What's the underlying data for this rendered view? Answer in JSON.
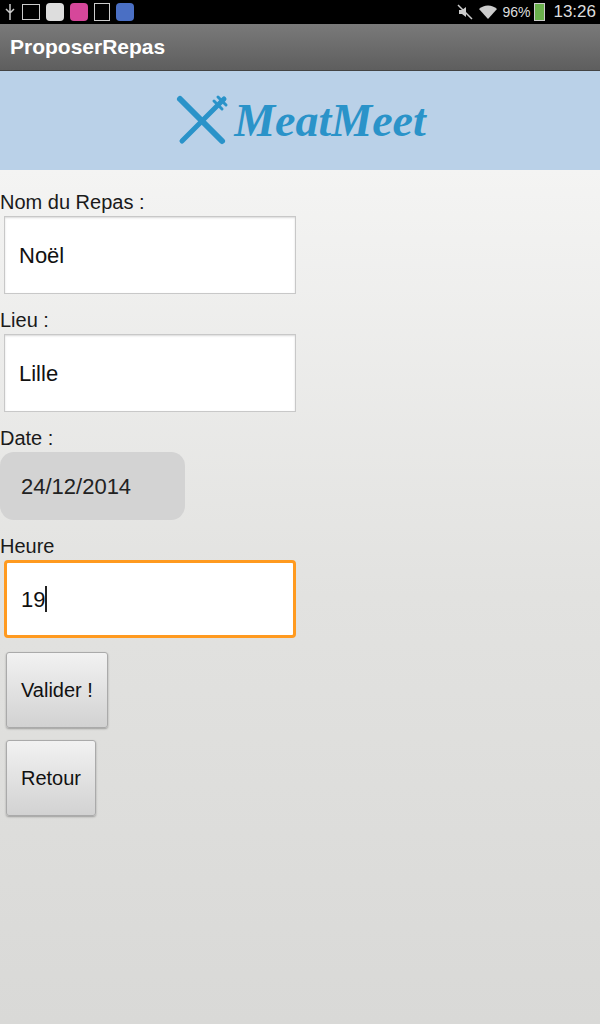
{
  "status_bar": {
    "battery": "96%",
    "time": "13:26"
  },
  "window": {
    "title": "ProposerRepas"
  },
  "logo": {
    "text": "MeatMeet"
  },
  "form": {
    "fields": [
      {
        "label": "Nom du Repas :",
        "value": "Noël",
        "kind": "text",
        "focused": false
      },
      {
        "label": "Lieu :",
        "value": "Lille",
        "kind": "text",
        "focused": false
      },
      {
        "label": "Date :",
        "value": "24/12/2014",
        "kind": "date",
        "focused": false
      },
      {
        "label": "Heure",
        "value": "19",
        "kind": "text",
        "focused": true
      }
    ]
  },
  "buttons": [
    "Valider !",
    "Retour"
  ]
}
